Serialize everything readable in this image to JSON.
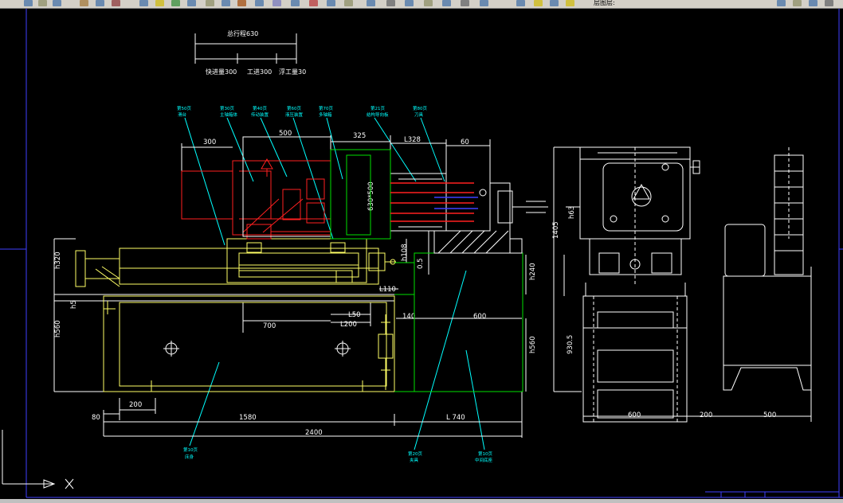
{
  "toolbar": {
    "layer_text": "层图层:"
  },
  "dims": {
    "total_stroke": "总行程630",
    "fast_forward": "快进量300",
    "work_feed": "工进300",
    "reverse": "浮工量30",
    "d300": "300",
    "d500": "500",
    "d325": "325",
    "l328": "L328",
    "d60": "60",
    "box": "630*500",
    "h108": "h108",
    "d05": "0.5",
    "h320": "h320",
    "h240": "h240",
    "l110": "L110",
    "h5": "h5",
    "d700": "700",
    "l50": "L50",
    "l200": "L200",
    "d140": "140",
    "d600": "600",
    "h560_left": "h560",
    "h560_right": "h560",
    "d200": "200",
    "d80": "80",
    "d1580": "1580",
    "l740": "L 740",
    "d2400": "2400",
    "h63": "h63",
    "d1405": "1405",
    "d930": "930.5",
    "d600_side": "600",
    "d200_side": "200",
    "d500_side": "500"
  },
  "callouts": [
    {
      "num": "第50页",
      "name": "滑台"
    },
    {
      "num": "第30页",
      "name": "主轴箱体"
    },
    {
      "num": "第40页",
      "name": "传动装置"
    },
    {
      "num": "第60页",
      "name": "液压装置"
    },
    {
      "num": "第70页",
      "name": "多轴箱"
    },
    {
      "num": "第21页",
      "name": "结构导向板"
    },
    {
      "num": "第80页",
      "name": "刀具"
    },
    {
      "num": "第10页",
      "name": "床身"
    },
    {
      "num": "第20页",
      "name": "夹具"
    },
    {
      "num": "第10页",
      "name": "中间底座"
    }
  ],
  "colors": {
    "background": "#000000",
    "line_white": "#ffffff",
    "line_yellow": "#ffff66",
    "line_red": "#ff2020",
    "line_green": "#00e000",
    "line_cyan": "#00ffff",
    "line_blue": "#4040ff",
    "toolbar_bg": "#d4d0c8"
  }
}
